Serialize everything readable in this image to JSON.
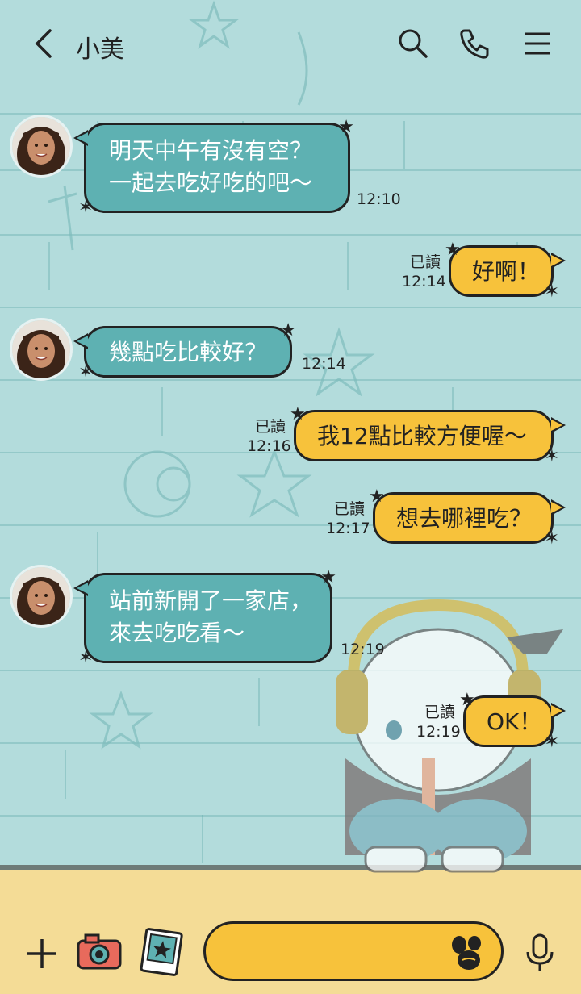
{
  "header": {
    "title": "小美",
    "back_icon": "chevron-left-icon",
    "search_icon": "search-icon",
    "call_icon": "phone-icon",
    "menu_icon": "menu-icon"
  },
  "theme": {
    "incoming_color": "#5eb1b2",
    "outgoing_color": "#f7c23b",
    "background_color": "#b3dcdc"
  },
  "messages": [
    {
      "direction": "in",
      "lines": [
        "明天中午有沒有空？",
        "一起去吃好吃的吧～"
      ],
      "time": "12:10"
    },
    {
      "direction": "out",
      "lines": [
        "好啊！"
      ],
      "read": "已讀",
      "time": "12:14"
    },
    {
      "direction": "in",
      "lines": [
        "幾點吃比較好？"
      ],
      "time": "12:14"
    },
    {
      "direction": "out",
      "lines": [
        "我12點比較方便喔～"
      ],
      "read": "已讀",
      "time": "12:16"
    },
    {
      "direction": "out",
      "lines": [
        "想去哪裡吃？"
      ],
      "read": "已讀",
      "time": "12:17"
    },
    {
      "direction": "in",
      "lines": [
        "站前新開了一家店，",
        "來去吃吃看～"
      ],
      "time": "12:19"
    },
    {
      "direction": "out",
      "lines": [
        "OK！"
      ],
      "read": "已讀",
      "time": "12:19"
    }
  ],
  "bottom_bar": {
    "plus_icon": "plus-icon",
    "camera_icon": "camera-icon",
    "photo_icon": "photo-icon",
    "input_value": "",
    "emoji_icon": "emoji-icon",
    "mic_icon": "microphone-icon"
  }
}
